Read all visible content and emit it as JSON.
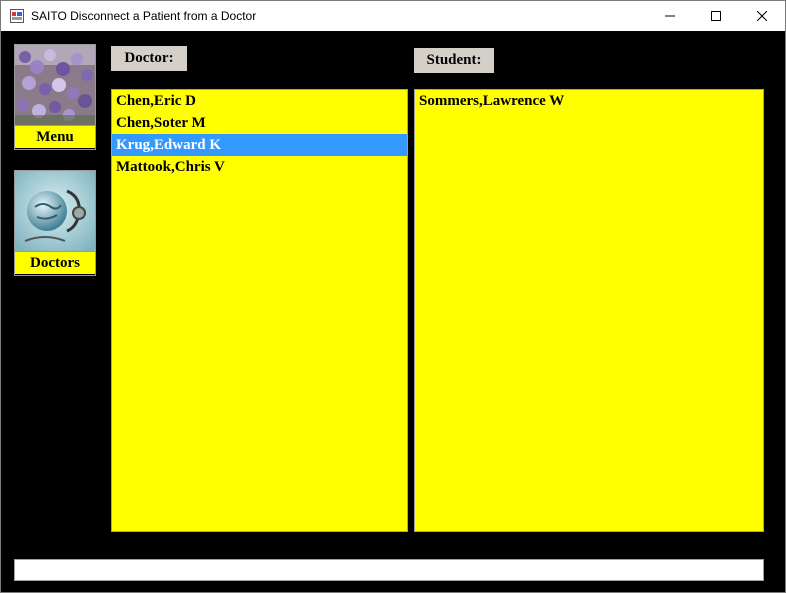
{
  "window": {
    "title": "SAITO Disconnect a Patient from a Doctor",
    "icons": {
      "app": "form-app-icon",
      "minimize": "minimize-icon",
      "maximize": "maximize-icon",
      "close": "close-icon"
    }
  },
  "nav": {
    "menu_label": "Menu",
    "menu_image": "wisteria-flowers-image",
    "doctors_label": "Doctors",
    "doctors_image": "globe-stethoscope-image"
  },
  "doctor_panel": {
    "label": "Doctor:",
    "items": [
      {
        "name": "Chen,Eric D",
        "selected": false
      },
      {
        "name": "Chen,Soter M",
        "selected": false
      },
      {
        "name": "Krug,Edward K",
        "selected": true
      },
      {
        "name": "Mattook,Chris V",
        "selected": false
      }
    ]
  },
  "student_panel": {
    "label": "Student:",
    "items": [
      {
        "name": "Sommers,Lawrence W",
        "selected": false
      }
    ]
  },
  "status": {
    "text": ""
  },
  "colors": {
    "list_background": "#ffff00",
    "selection": "#3399ff",
    "window_background": "#000000",
    "label_background": "#d4d0c8"
  }
}
